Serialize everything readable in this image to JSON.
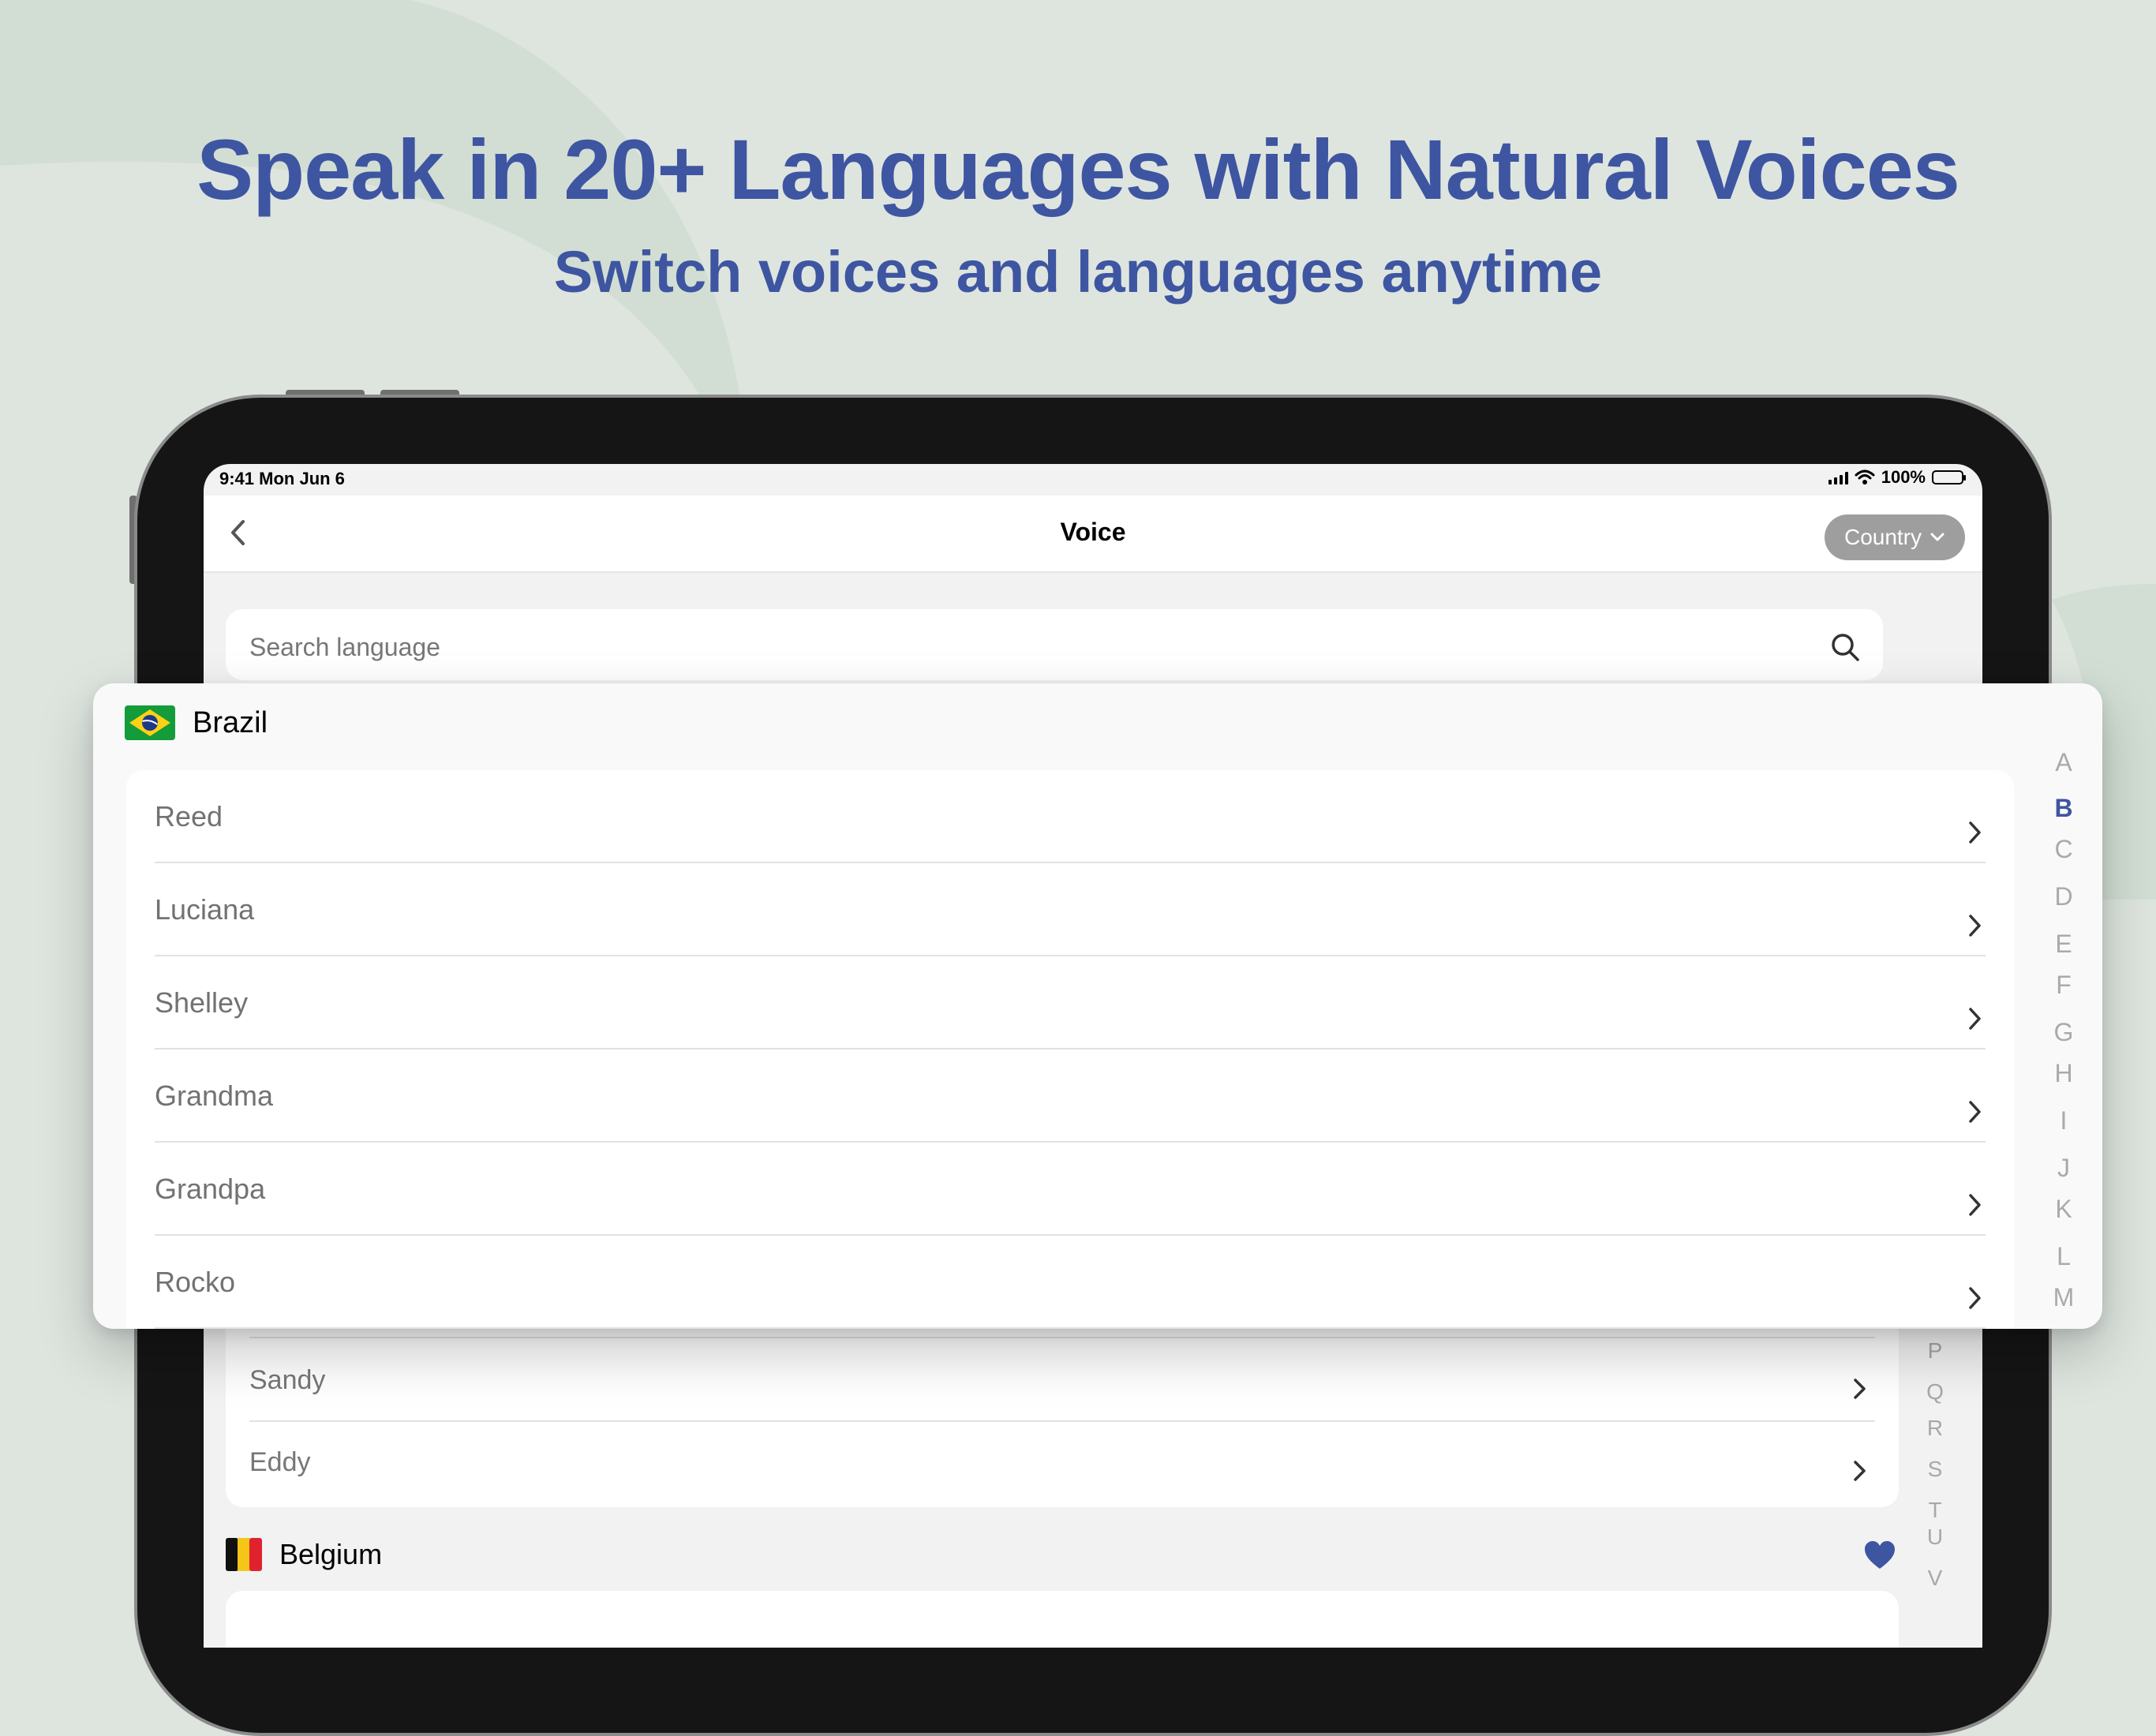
{
  "headline": "Speak in 20+ Languages with Natural Voices",
  "subheadline": "Switch voices and languages anytime",
  "status_bar": {
    "time": "9:41  Mon Jun 6",
    "battery": "100%"
  },
  "nav": {
    "title": "Voice",
    "country_button": "Country"
  },
  "search": {
    "placeholder": "Search language"
  },
  "background_list": {
    "rows": [
      "Sandy",
      "Eddy"
    ],
    "next_section": "Belgium"
  },
  "popup": {
    "section": "Brazil",
    "rows": [
      "Reed",
      "Luciana",
      "Shelley",
      "Grandma",
      "Grandpa",
      "Rocko"
    ]
  },
  "index_letters": [
    "A",
    "B",
    "C",
    "D",
    "E",
    "F",
    "G",
    "H",
    "I",
    "J",
    "K",
    "L",
    "M"
  ],
  "index_active": "B",
  "index_letters_under": [
    "P",
    "Q",
    "R",
    "S",
    "T",
    "U",
    "V"
  ],
  "colors": {
    "accent": "#3e55a1",
    "background": "#dee5df"
  },
  "icons": [
    "back-chevron-icon",
    "chevron-down-icon",
    "search-icon",
    "chevron-right-icon",
    "heart-icon",
    "brazil-flag-icon",
    "belgium-flag-icon",
    "signal-icon",
    "wifi-icon",
    "battery-icon"
  ]
}
